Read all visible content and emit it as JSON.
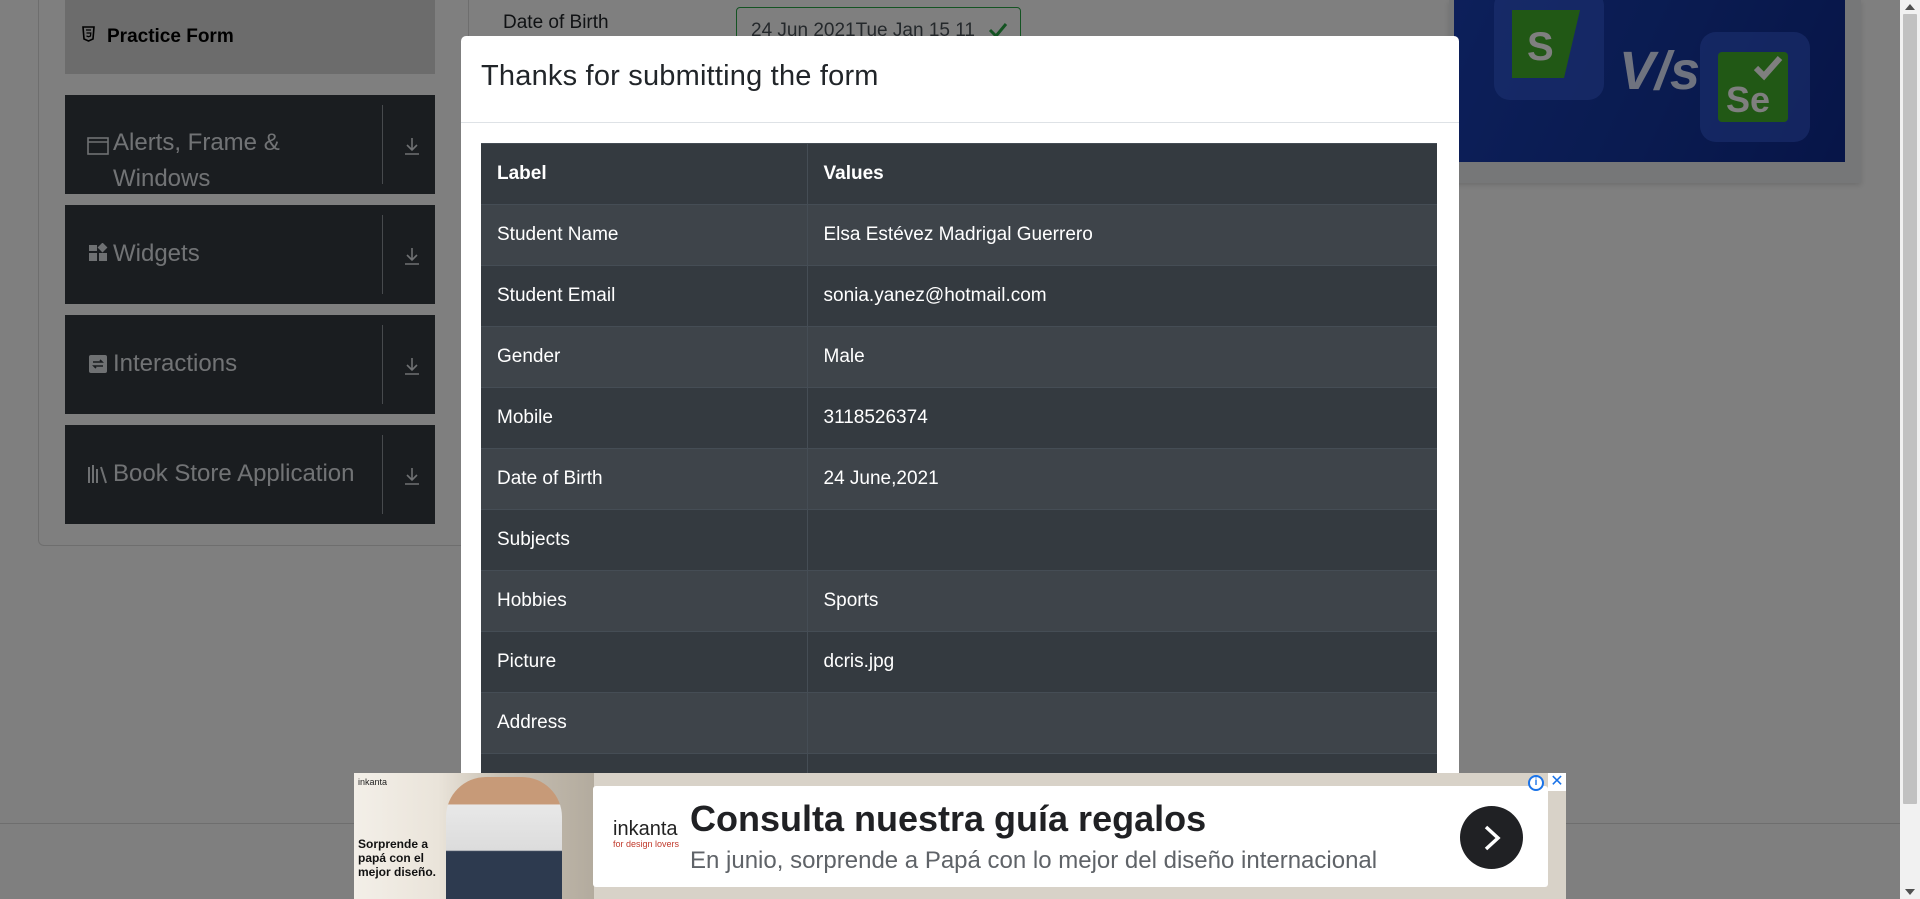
{
  "sidebar": {
    "active_item": "Practice Form",
    "groups": [
      {
        "label": "Alerts, Frame & Windows",
        "icon": "window-icon"
      },
      {
        "label": "Widgets",
        "icon": "widgets-icon"
      },
      {
        "label": "Interactions",
        "icon": "interactions-icon"
      },
      {
        "label": "Book Store Application",
        "icon": "books-icon"
      }
    ]
  },
  "form": {
    "dob_label": "Date of Birth",
    "dob_value": "24 Jun 2021Tue Jan 15 11"
  },
  "modal": {
    "title": "Thanks for submitting the form",
    "headers": {
      "label": "Label",
      "values": "Values"
    },
    "rows": [
      {
        "label": "Student Name",
        "value": "Elsa Estévez Madrigal Guerrero"
      },
      {
        "label": "Student Email",
        "value": "sonia.yanez@hotmail.com"
      },
      {
        "label": "Gender",
        "value": "Male"
      },
      {
        "label": "Mobile",
        "value": "3118526374"
      },
      {
        "label": "Date of Birth",
        "value": "24 June,2021"
      },
      {
        "label": "Subjects",
        "value": ""
      },
      {
        "label": "Hobbies",
        "value": "Sports"
      },
      {
        "label": "Picture",
        "value": "dcris.jpg"
      },
      {
        "label": "Address",
        "value": ""
      },
      {
        "label": "",
        "value": ""
      }
    ]
  },
  "banner": {
    "vs_text": "V/s"
  },
  "ad": {
    "brand": "inkanta",
    "brand_tagline": "for design lovers",
    "image_text": "Sorprende a papá con el mejor diseño.",
    "headline": "Consulta nuestra guía regalos",
    "subtext": "En junio, sorprende a Papá con lo mejor del diseño internacional",
    "info_label": "i",
    "close_label": "✕"
  },
  "colors": {
    "sidebar_bg": "#343a40",
    "table_bg": "#343a40",
    "valid_green": "#28a745",
    "ad_link": "#1a73e8"
  }
}
